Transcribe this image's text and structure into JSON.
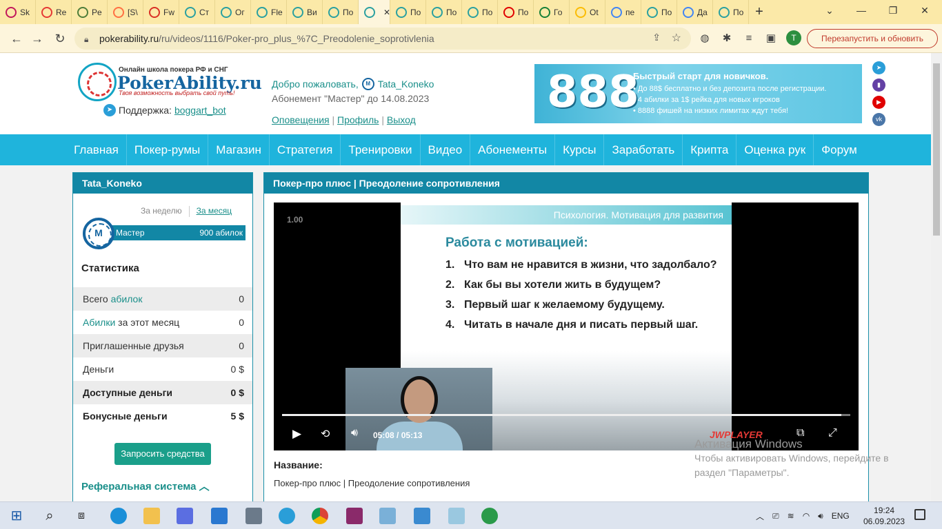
{
  "tabs": [
    {
      "label": "Sk",
      "fav": "#c2185b"
    },
    {
      "label": "Re",
      "fav": "#e53935"
    },
    {
      "label": "Pe",
      "fav": "#4e7d3a"
    },
    {
      "label": "[S\\",
      "fav": "#ff7043"
    },
    {
      "label": "Fw",
      "fav": "#d93025"
    },
    {
      "label": "Ст",
      "fav": "#2aa0a0"
    },
    {
      "label": "Ог",
      "fav": "#2aa0a0"
    },
    {
      "label": "Fle",
      "fav": "#2aa0a0"
    },
    {
      "label": "Ви",
      "fav": "#2aa0a0"
    },
    {
      "label": "По",
      "fav": "#2aa0a0"
    },
    {
      "label": "",
      "fav": "#2aa0a0",
      "active": true
    },
    {
      "label": "По",
      "fav": "#2aa0a0"
    },
    {
      "label": "По",
      "fav": "#2aa0a0"
    },
    {
      "label": "По",
      "fav": "#2aa0a0"
    },
    {
      "label": "По",
      "fav": "#e00000"
    },
    {
      "label": "Го",
      "fav": "#188038"
    },
    {
      "label": "Ot",
      "fav": "#fbbc04"
    },
    {
      "label": "пе",
      "fav": "#4285f4"
    },
    {
      "label": "По",
      "fav": "#2aa0a0"
    },
    {
      "label": "Да",
      "fav": "#4285f4"
    },
    {
      "label": "По",
      "fav": "#2aa0a0"
    }
  ],
  "browser": {
    "url_host": "pokerability.ru",
    "url_path": "/ru/videos/1116/Poker-pro_plus_%7C_Preodolenie_soprotivlenia",
    "profile_letter": "T",
    "relaunch_label": "Перезапустить и обновить"
  },
  "header": {
    "logo_top": "Онлайн школа покера РФ и СНГ",
    "logo_name": "PokerAbility.ru",
    "logo_tagline": "Твоя возможность выбрать свой путь!",
    "support_label": "Поддержка:",
    "support_link": "boggart_bot",
    "welcome": "Добро пожаловать,",
    "username": "Tata_Koneko",
    "subscription": "Абонемент \"Мастер\" до 14.08.2023",
    "links": [
      "Оповещения",
      "Профиль",
      "Выход"
    ],
    "banner": {
      "big": "888",
      "title": "Быстрый старт для новичков.",
      "lines": [
        "• До 88$ бесплатно и без депозита после регистрации.",
        "• 4 абилки за 1$ рейка для новых игроков",
        "• 8888 фишей на низких лимитах ждут тебя!"
      ]
    }
  },
  "nav": [
    "Главная",
    "Покер-румы",
    "Магазин",
    "Стратегия",
    "Тренировки",
    "Видео",
    "Абонементы",
    "Курсы",
    "Заработать",
    "Крипта",
    "Оценка рук",
    "Форум"
  ],
  "sidebar": {
    "title": "Tata_Koneko",
    "period_week": "За неделю",
    "period_month": "За месяц",
    "rank_letter": "М",
    "rank_name": "Мастер",
    "rank_value": "900 абилок",
    "stats_title": "Статистика",
    "stats": [
      {
        "pre": "Всего ",
        "hl": "абилок",
        "post": "",
        "value": "0",
        "bold": false
      },
      {
        "pre": "",
        "hl": "Абилки",
        "post": " за этот месяц",
        "value": "0",
        "bold": false
      },
      {
        "pre": "Приглашенные друзья",
        "hl": "",
        "post": "",
        "value": "0",
        "bold": false
      },
      {
        "pre": "Деньги",
        "hl": "",
        "post": "",
        "value": "0 $",
        "bold": false
      },
      {
        "pre": "Доступные деньги",
        "hl": "",
        "post": "",
        "value": "0 $",
        "bold": true
      },
      {
        "pre": "Бонусные деньги",
        "hl": "",
        "post": "",
        "value": "5 $",
        "bold": true
      }
    ],
    "request_button": "Запросить средства",
    "referral_title": "Реферальная система"
  },
  "main": {
    "title": "Покер-про плюс | Преодоление сопротивления",
    "slide": {
      "header": "Психология. Мотивация для развития",
      "title": "Работа с мотивацией:",
      "items": [
        {
          "n": "1.",
          "text": "Что вам не нравится в жизни, что задолбало?"
        },
        {
          "n": "2.",
          "text": "Как бы вы хотели жить в будущем?"
        },
        {
          "n": "3.",
          "text": "Первый шаг к желаемому будущему."
        },
        {
          "n": "4.",
          "text": "Читать в начале дня и писать первый шаг."
        }
      ]
    },
    "player": {
      "playback_rate": "1.00",
      "time_current": "05:08",
      "time_sep": "/",
      "time_total": "05:13",
      "progress": 0.984,
      "brand": "JWPLAYER"
    },
    "name_label": "Название:",
    "name_value": "Покер-про плюс | Преодоление сопротивления"
  },
  "activation": {
    "title": "Активация Windows",
    "line1": "Чтобы активировать Windows, перейдите в",
    "line2": "раздел \"Параметры\"."
  },
  "taskbar": {
    "lang": "ENG",
    "time": "19:24",
    "date": "06.09.2023"
  }
}
